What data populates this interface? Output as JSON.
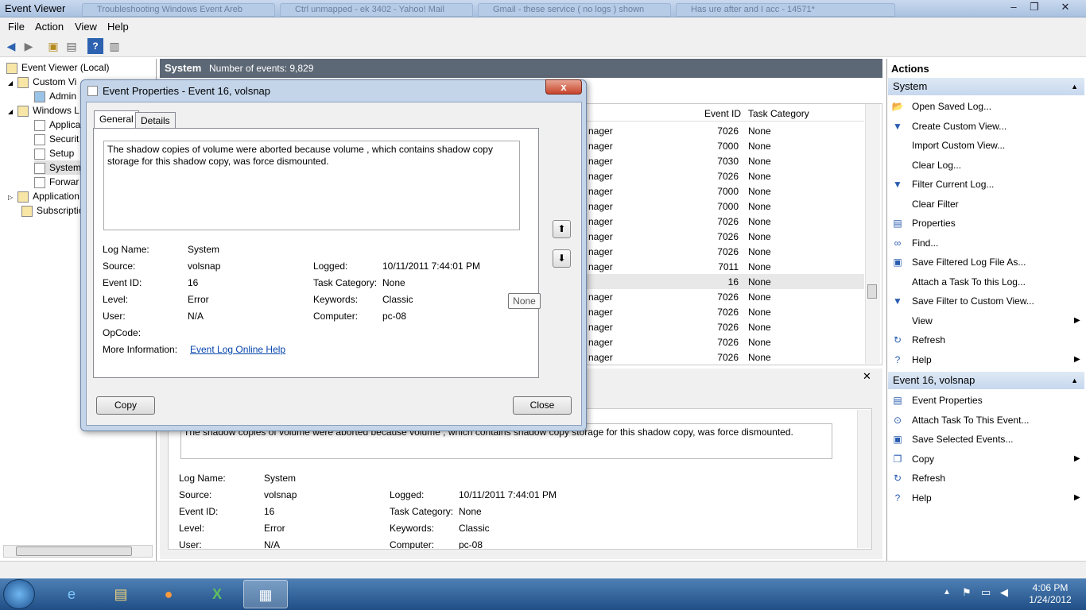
{
  "window": {
    "title": "Event Viewer",
    "ghost_tabs": [
      "Troubleshooting Windows Event Areb",
      "Ctrl unmapped - ek 3402 - Yahoo! Mail",
      "Gmail - these service ( no logs ) shown",
      "Has ure after and I acc - 14571*"
    ],
    "minimize": "–",
    "maximize": "❐",
    "close": "✕"
  },
  "menu": [
    "File",
    "Action",
    "View",
    "Help"
  ],
  "tree": {
    "items": [
      {
        "label": "Event Viewer (Local)"
      },
      {
        "label": "Custom Vi"
      },
      {
        "label": "Admin"
      },
      {
        "label": "Windows L"
      },
      {
        "label": "Applica"
      },
      {
        "label": "Securit"
      },
      {
        "label": "Setup"
      },
      {
        "label": "System"
      },
      {
        "label": "Forwar"
      },
      {
        "label": "Application"
      },
      {
        "label": "Subscriptio"
      }
    ]
  },
  "center": {
    "log_name": "System",
    "count": "Number of events: 9,829",
    "col_event_id": "Event ID",
    "col_task": "Task Category",
    "rows": [
      {
        "src": "nager",
        "id": "7026",
        "task": "None"
      },
      {
        "src": "nager",
        "id": "7000",
        "task": "None"
      },
      {
        "src": "nager",
        "id": "7030",
        "task": "None"
      },
      {
        "src": "nager",
        "id": "7026",
        "task": "None"
      },
      {
        "src": "nager",
        "id": "7000",
        "task": "None"
      },
      {
        "src": "nager",
        "id": "7000",
        "task": "None"
      },
      {
        "src": "nager",
        "id": "7026",
        "task": "None"
      },
      {
        "src": "nager",
        "id": "7026",
        "task": "None"
      },
      {
        "src": "nager",
        "id": "7026",
        "task": "None"
      },
      {
        "src": "nager",
        "id": "7011",
        "task": "None"
      },
      {
        "src": "",
        "id": "16",
        "task": "None"
      },
      {
        "src": "nager",
        "id": "7026",
        "task": "None"
      },
      {
        "src": "nager",
        "id": "7026",
        "task": "None"
      },
      {
        "src": "nager",
        "id": "7026",
        "task": "None"
      },
      {
        "src": "nager",
        "id": "7026",
        "task": "None"
      },
      {
        "src": "nager",
        "id": "7026",
        "task": "None"
      }
    ]
  },
  "detail": {
    "close": "✕",
    "message": "The shadow copies of volume  were aborted because volume , which contains shadow copy storage for this shadow copy, was force dismounted.",
    "log_name_l": "Log Name:",
    "log_name": "System",
    "source_l": "Source:",
    "source": "volsnap",
    "logged_l": "Logged:",
    "logged": "10/11/2011 7:44:01 PM",
    "event_id_l": "Event ID:",
    "event_id": "16",
    "task_l": "Task Category:",
    "task": "None",
    "level_l": "Level:",
    "level": "Error",
    "keywords_l": "Keywords:",
    "keywords": "Classic",
    "user_l": "User:",
    "user": "N/A",
    "computer_l": "Computer:",
    "computer": "pc-08"
  },
  "actions": {
    "title": "Actions",
    "section1": "System",
    "items1": [
      {
        "label": "Open Saved Log...",
        "icon": "folder-icon"
      },
      {
        "label": "Create Custom View...",
        "icon": "filter-icon"
      },
      {
        "label": "Import Custom View...",
        "icon": ""
      },
      {
        "label": "Clear Log...",
        "icon": ""
      },
      {
        "label": "Filter Current Log...",
        "icon": "filter-icon"
      },
      {
        "label": "Clear Filter",
        "icon": ""
      },
      {
        "label": "Properties",
        "icon": "properties-icon"
      },
      {
        "label": "Find...",
        "icon": "binoculars-icon"
      },
      {
        "label": "Save Filtered Log File As...",
        "icon": "save-icon"
      },
      {
        "label": "Attach a Task To this Log...",
        "icon": ""
      },
      {
        "label": "Save Filter to Custom View...",
        "icon": "filter-icon"
      },
      {
        "label": "View",
        "icon": "",
        "arrow": "▶"
      },
      {
        "label": "Refresh",
        "icon": "refresh-icon"
      },
      {
        "label": "Help",
        "icon": "help-icon",
        "arrow": "▶"
      }
    ],
    "section2": "Event 16, volsnap",
    "items2": [
      {
        "label": "Event Properties",
        "icon": "properties-icon"
      },
      {
        "label": "Attach Task To This Event...",
        "icon": "task-icon"
      },
      {
        "label": "Save Selected Events...",
        "icon": "save-icon"
      },
      {
        "label": "Copy",
        "icon": "copy-icon",
        "arrow": "▶"
      },
      {
        "label": "Refresh",
        "icon": "refresh-icon"
      },
      {
        "label": "Help",
        "icon": "help-icon",
        "arrow": "▶"
      }
    ]
  },
  "dialog": {
    "title": "Event Properties - Event 16, volsnap",
    "close": "x",
    "tab_general": "General",
    "tab_details": "Details",
    "message": "The shadow copies of volume  were aborted because volume , which contains shadow copy storage for this shadow copy, was force dismounted.",
    "log_name_l": "Log Name:",
    "log_name": "System",
    "source_l": "Source:",
    "source": "volsnap",
    "logged_l": "Logged:",
    "logged": "10/11/2011 7:44:01 PM",
    "event_id_l": "Event ID:",
    "event_id": "16",
    "task_l": "Task Category:",
    "task": "None",
    "level_l": "Level:",
    "level": "Error",
    "keywords_l": "Keywords:",
    "keywords": "Classic",
    "user_l": "User:",
    "user": "N/A",
    "computer_l": "Computer:",
    "computer": "pc-08",
    "opcode_l": "OpCode:",
    "moreinfo_l": "More Information:",
    "moreinfo_link": "Event Log Online Help",
    "copy": "Copy",
    "close_btn": "Close",
    "tooltip": "None"
  },
  "taskbar": {
    "time": "4:06 PM",
    "date": "1/24/2012"
  }
}
